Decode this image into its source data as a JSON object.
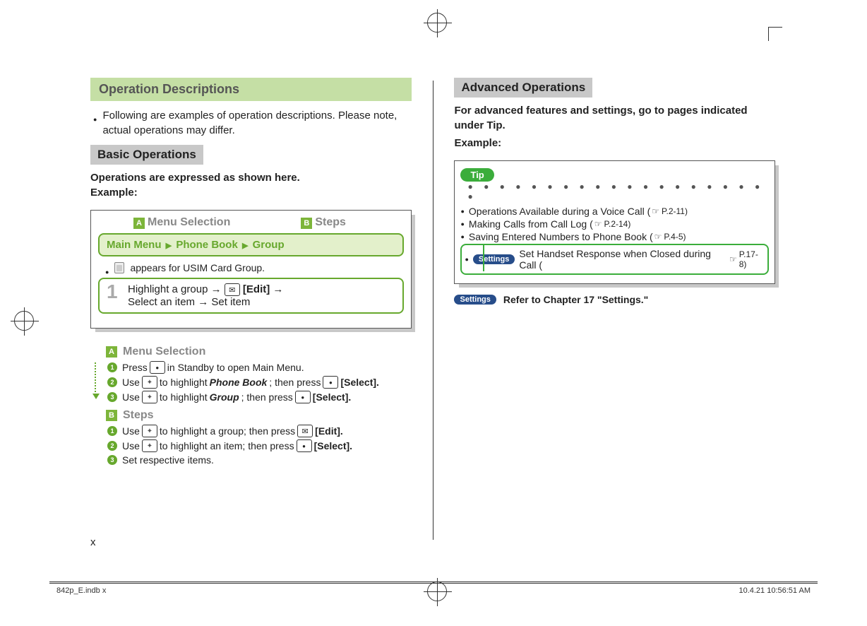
{
  "left": {
    "title": "Operation Descriptions",
    "intro": "Following are examples of operation descriptions. Please note, actual operations may differ.",
    "basic_heading": "Basic Operations",
    "basic_intro1": "Operations are expressed as shown here.",
    "basic_intro2": "Example:",
    "label_a": "Menu Selection",
    "label_b": "Steps",
    "tag_a": "A",
    "tag_b": "B",
    "greenbar": {
      "p1": "Main Menu",
      "p2": "Phone Book",
      "p3": "Group"
    },
    "usim_note": "appears for USIM Card Group.",
    "step_num": "1",
    "step_text1": "Highlight a group → ",
    "step_edit": "[Edit]",
    "step_text2": "Select an item → Set item",
    "expA": {
      "head": "Menu Selection",
      "l1a": "Press",
      "l1b": "in Standby to open Main Menu.",
      "l2a": "Use",
      "l2b": "to highlight",
      "l2c": "Phone Book",
      "l2d": "; then press",
      "l2e": "[Select].",
      "l3a": "Use",
      "l3b": "to highlight",
      "l3c": "Group",
      "l3d": "; then press",
      "l3e": "[Select]."
    },
    "expB": {
      "head": "Steps",
      "l1a": "Use",
      "l1b": "to highlight a group; then press",
      "l1c": "[Edit].",
      "l2a": "Use",
      "l2b": "to highlight an item; then press",
      "l2c": "[Select].",
      "l3": "Set respective items."
    }
  },
  "right": {
    "title": "Advanced Operations",
    "intro1": "For advanced features and settings, go to pages indicated under Tip.",
    "intro2": "Example:",
    "tip_label": "Tip",
    "dots": "● ● ● ● ● ● ● ● ● ● ● ● ● ● ● ● ● ● ● ●",
    "items": [
      {
        "t": "Operations Available during a Voice Call (",
        "r": "P.2-11)"
      },
      {
        "t": "Making Calls from Call Log (",
        "r": "P.2-14)"
      },
      {
        "t": "Saving Entered Numbers to Phone Book (",
        "r": "P.4-5)"
      }
    ],
    "settings_label": "Settings",
    "settings_item": {
      "t": "Set Handset Response when Closed during Call (",
      "r": "P.17-8)"
    },
    "note": "Refer to Chapter 17 \"Settings.\""
  },
  "footer": {
    "page": "x",
    "file": "842p_E.indb   x",
    "timestamp": "10.4.21   10:56:51 AM"
  }
}
